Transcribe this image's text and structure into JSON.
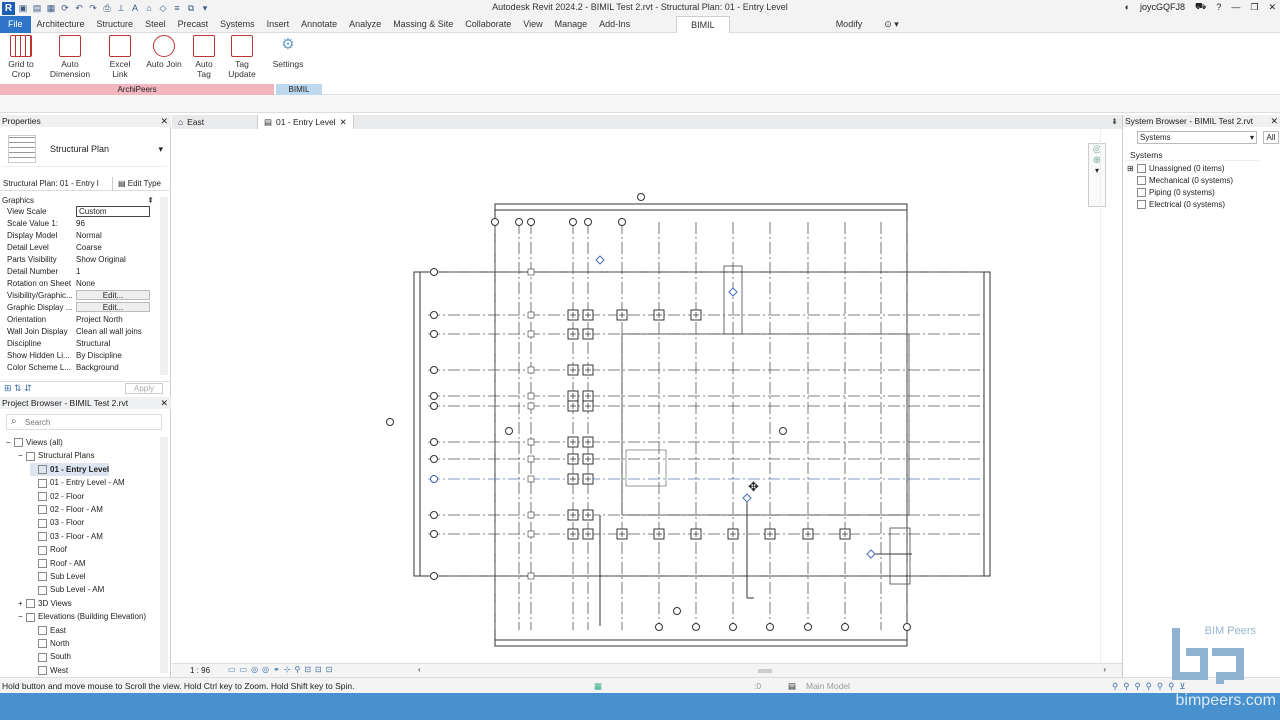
{
  "window": {
    "title": "Autodesk Revit 2024.2 - BIMIL Test 2.rvt - Structural Plan: 01 - Entry Level",
    "user": "joycGQFJ8"
  },
  "menu_tabs": [
    "File",
    "Architecture",
    "Structure",
    "Steel",
    "Precast",
    "Systems",
    "Insert",
    "Annotate",
    "Analyze",
    "Massing & Site",
    "Collaborate",
    "View",
    "Manage",
    "Add-Ins",
    "BIMIL",
    "Modify"
  ],
  "ribbon": {
    "buttons": [
      {
        "label1": "Grid to",
        "label2": "Crop"
      },
      {
        "label1": "Auto",
        "label2": "Dimension"
      },
      {
        "label1": "Excel Link",
        "label2": ""
      },
      {
        "label1": "Auto Join",
        "label2": ""
      },
      {
        "label1": "Auto",
        "label2": "Tag"
      },
      {
        "label1": "Tag",
        "label2": "Update"
      },
      {
        "label1": "Settings",
        "label2": ""
      }
    ],
    "panel_archipeers": "ArchiPeers",
    "panel_bimil": "BIMIL",
    "colors": {
      "archipeers": "#f2b6bf",
      "bimil": "#bcd8ee"
    }
  },
  "properties": {
    "title": "Properties",
    "type_name": "Structural Plan",
    "instance": "Structural Plan: 01 - Entry l",
    "edit_type": "Edit Type",
    "group": "Graphics",
    "rows": [
      {
        "k": "View Scale",
        "v": "Custom"
      },
      {
        "k": "Scale Value    1:",
        "v": "96"
      },
      {
        "k": "Display Model",
        "v": "Normal"
      },
      {
        "k": "Detail Level",
        "v": "Coarse"
      },
      {
        "k": "Parts Visibility",
        "v": "Show Original"
      },
      {
        "k": "Detail Number",
        "v": "1"
      },
      {
        "k": "Rotation on Sheet",
        "v": "None"
      },
      {
        "k": "Visibility/Graphic...",
        "v": "Edit..."
      },
      {
        "k": "Graphic Display ...",
        "v": "Edit..."
      },
      {
        "k": "Orientation",
        "v": "Project North"
      },
      {
        "k": "Wall Join Display",
        "v": "Clean all wall joins"
      },
      {
        "k": "Discipline",
        "v": "Structural"
      },
      {
        "k": "Show Hidden Li...",
        "v": "By Discipline"
      },
      {
        "k": "Color Scheme L...",
        "v": "Background"
      }
    ],
    "apply": "Apply"
  },
  "project_browser": {
    "title": "Project Browser - BIMIL Test 2.rvt",
    "search_placeholder": "Search",
    "items": [
      {
        "label": "Views (all)",
        "indent": 0,
        "toggle": "−"
      },
      {
        "label": "Structural Plans",
        "indent": 1,
        "toggle": "−"
      },
      {
        "label": "01 - Entry Level",
        "indent": 2,
        "toggle": "",
        "selected": true
      },
      {
        "label": "01 - Entry Level - AM",
        "indent": 2,
        "toggle": ""
      },
      {
        "label": "02 - Floor",
        "indent": 2,
        "toggle": ""
      },
      {
        "label": "02 - Floor - AM",
        "indent": 2,
        "toggle": ""
      },
      {
        "label": "03 - Floor",
        "indent": 2,
        "toggle": ""
      },
      {
        "label": "03 - Floor - AM",
        "indent": 2,
        "toggle": ""
      },
      {
        "label": "Roof",
        "indent": 2,
        "toggle": ""
      },
      {
        "label": "Roof - AM",
        "indent": 2,
        "toggle": ""
      },
      {
        "label": "Sub Level",
        "indent": 2,
        "toggle": ""
      },
      {
        "label": "Sub Level - AM",
        "indent": 2,
        "toggle": ""
      },
      {
        "label": "3D Views",
        "indent": 1,
        "toggle": "+"
      },
      {
        "label": "Elevations (Building Elevation)",
        "indent": 1,
        "toggle": "−"
      },
      {
        "label": "East",
        "indent": 2,
        "toggle": ""
      },
      {
        "label": "North",
        "indent": 2,
        "toggle": ""
      },
      {
        "label": "South",
        "indent": 2,
        "toggle": ""
      },
      {
        "label": "West",
        "indent": 2,
        "toggle": ""
      }
    ]
  },
  "view_tabs": [
    {
      "label": "East",
      "active": false
    },
    {
      "label": "01 - Entry Level",
      "active": true
    }
  ],
  "view_control": {
    "scale": "1 : 96"
  },
  "system_browser": {
    "title": "System Browser - BIMIL Test 2.rvt",
    "dropdown": "Systems",
    "all_btn": "All",
    "col": "Systems",
    "items": [
      "Unassigned (0 items)",
      "Mechanical (0 systems)",
      "Piping (0 systems)",
      "Electrical (0 systems)"
    ]
  },
  "status": {
    "text": "Hold button and move mouse to Scroll the view. Hold Ctrl key to Zoom. Hold Shift key to Spin.",
    "zero": ":0",
    "model": "Main Model"
  },
  "watermark": {
    "brand": "BIM Peers",
    "url": "bimpeers.com"
  }
}
